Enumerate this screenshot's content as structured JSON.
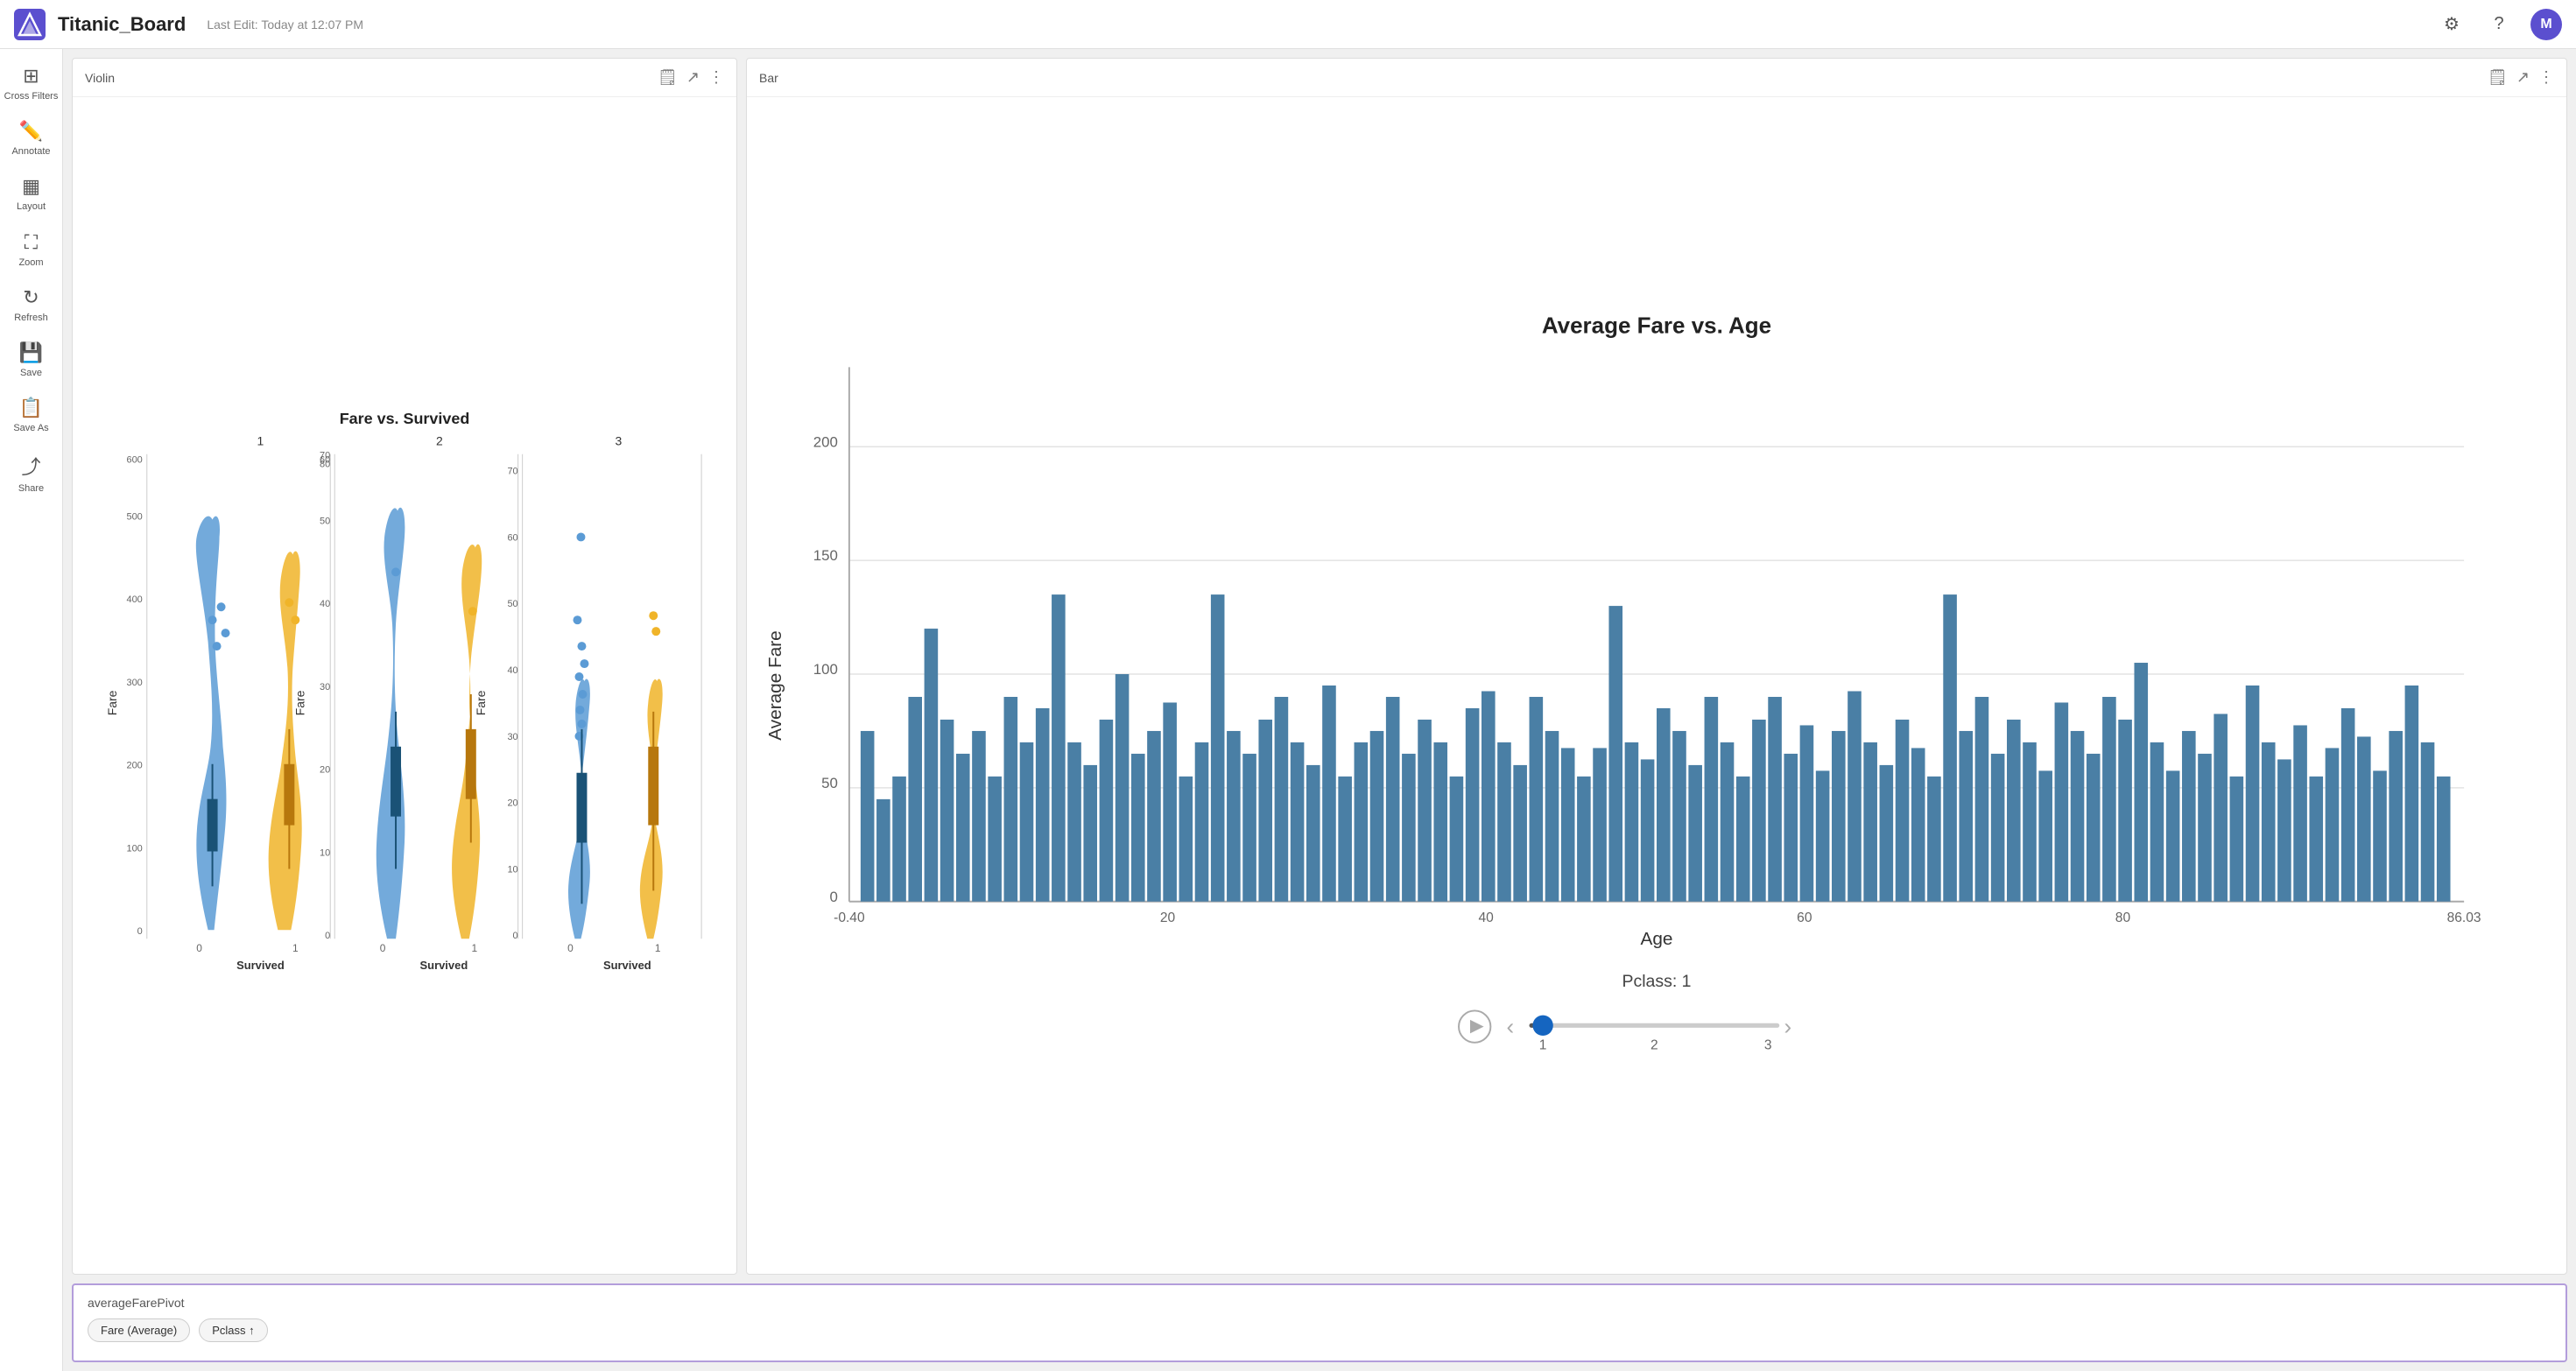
{
  "header": {
    "title": "Titanic_Board",
    "last_edit": "Last Edit: Today at 12:07 PM",
    "avatar_letter": "M"
  },
  "sidebar": {
    "items": [
      {
        "id": "cross-filters",
        "label": "Cross Filters",
        "icon": "⊞"
      },
      {
        "id": "annotate",
        "label": "Annotate",
        "icon": "✏️"
      },
      {
        "id": "layout",
        "label": "Layout",
        "icon": "▦"
      },
      {
        "id": "zoom",
        "label": "Zoom",
        "icon": "⛶"
      },
      {
        "id": "refresh",
        "label": "Refresh",
        "icon": "↻"
      },
      {
        "id": "save",
        "label": "Save",
        "icon": "💾"
      },
      {
        "id": "save-as",
        "label": "Save As",
        "icon": "📋"
      },
      {
        "id": "share",
        "label": "Share",
        "icon": "⤴"
      }
    ]
  },
  "violin_chart": {
    "type_label": "Violin",
    "title": "Fare vs. Survived",
    "subtitle1": "1",
    "subtitle2": "2",
    "subtitle3": "3",
    "x_label": "Survived",
    "y_label": "Fare",
    "x_ticks": [
      "0",
      "1"
    ],
    "y_ticks": [
      "0",
      "100",
      "200",
      "300",
      "400",
      "500",
      "600"
    ]
  },
  "bar_chart": {
    "type_label": "Bar",
    "title": "Average Fare vs. Age",
    "x_label": "Age",
    "y_label": "Average Fare",
    "x_min": "-0.40",
    "x_max": "86.03",
    "x_ticks": [
      "-0.40",
      "20",
      "40",
      "60",
      "80",
      "86.03"
    ],
    "y_ticks": [
      "0",
      "50",
      "100",
      "150",
      "200"
    ],
    "slider_label": "Pclass: 1",
    "slider_min": "1",
    "slider_max": "3",
    "slider_mid": "2"
  },
  "bottom_panel": {
    "title": "averageFarePivot",
    "chips": [
      {
        "label": "Fare (Average)"
      },
      {
        "label": "Pclass ↑"
      }
    ]
  },
  "icons": {
    "save_doc": "🗒",
    "external_link": "↗",
    "more_vert": "⋮",
    "play": "▶",
    "chevron_left": "‹",
    "chevron_right": "›",
    "gear": "⚙",
    "help": "?",
    "filter": "⊞"
  }
}
